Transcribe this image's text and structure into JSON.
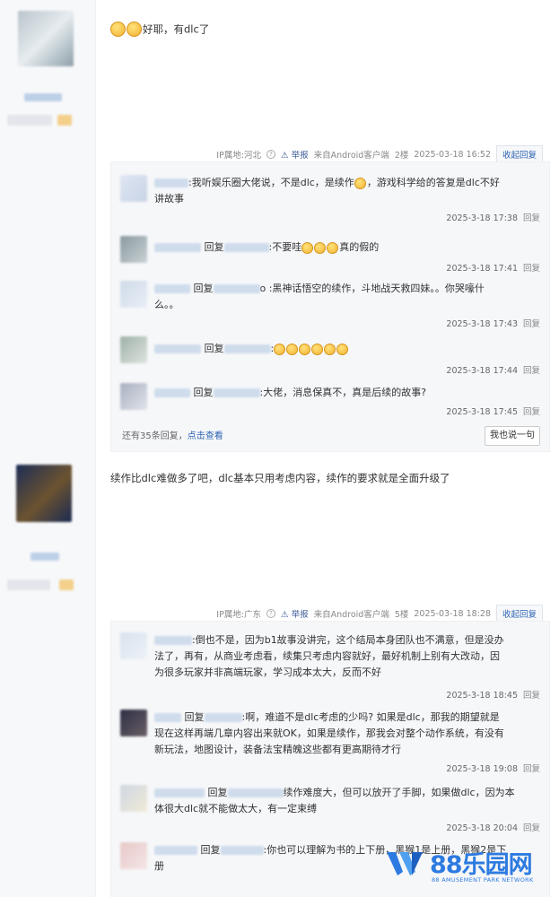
{
  "post1": {
    "text": "好耶，有dlc了",
    "meta": {
      "ip": "IP属地:河北",
      "report": "举报",
      "client": "来自Android客户端",
      "floor": "2楼",
      "time": "2025-03-18 16:52",
      "collapse": "收起回复"
    },
    "comments": [
      {
        "prefix": ":",
        "text_a": "我听娱乐圈大佬说，不是dlc，是续作",
        "text_b": "，游戏科学给的答复是dlc不好",
        "line2": "讲故事",
        "time": "2025-3-18 17:38",
        "reply": "回复"
      },
      {
        "prefix": "回复",
        "text_a": ":不要哇",
        "text_b": "真的假的",
        "time": "2025-3-18 17:41",
        "reply": "回复"
      },
      {
        "prefix": "回复",
        "text_a": "o :黑神话悟空的续作，斗地战天救四妹。。你哭嚎什",
        "line2": "么。。",
        "time": "2025-3-18 17:43",
        "reply": "回复"
      },
      {
        "prefix": "回复",
        "text_a": ":",
        "time": "2025-3-18 17:44",
        "reply": "回复"
      },
      {
        "prefix": "回复",
        "text_a": ":大佬，消息保真不，真是后续的故事?",
        "time": "2025-3-18 17:45",
        "reply": "回复"
      }
    ],
    "more_prefix": "还有35条回复，",
    "more_link": "点击查看",
    "say_button": "我也说一句"
  },
  "post2": {
    "text": "续作比dlc难做多了吧，dlc基本只用考虑内容，续作的要求就是全面升级了",
    "meta": {
      "ip": "IP属地:广东",
      "report": "举报",
      "client": "来自Android客户端",
      "floor": "5楼",
      "time": "2025-03-18 18:28",
      "collapse": "收起回复"
    },
    "comments": [
      {
        "text_a": ":倒也不是，因为b1故事没讲完，这个结局本身团队也不满意，但是没办",
        "line2": "法了，再有，从商业考虑看，续集只考虑内容就好，最好机制上别有大改动，因",
        "line3": "为很多玩家并非高端玩家，学习成本太大，反而不好",
        "time": "2025-3-18 18:45",
        "reply": "回复"
      },
      {
        "prefix": "回复",
        "text_a": ":啊，难道不是dlc考虑的少吗? 如果是dlc，那我的期望就是",
        "line2": "现在这样再端几章内容出来就OK，如果是续作，那我会对整个动作系统，有没有",
        "line3": "新玩法，地图设计，装备法宝精魄这些都有更高期待才行",
        "time": "2025-3-18 19:08",
        "reply": "回复"
      },
      {
        "prefix": "回复",
        "text_a": "续作难度大，但可以放开了手脚，如果做dlc，因为本",
        "line2": "体很大dlc就不能做太大，有一定束缚",
        "time": "2025-3-18 20:04",
        "reply": "回复"
      },
      {
        "prefix": "回复",
        "text_a": ":你也可以理解为书的上下册，黑猴1是上册，黑猴2是下",
        "line2": "册"
      }
    ]
  },
  "watermark": {
    "text": "88乐园网",
    "sub": "88 AMUSEMENT PARK NETWORK"
  }
}
